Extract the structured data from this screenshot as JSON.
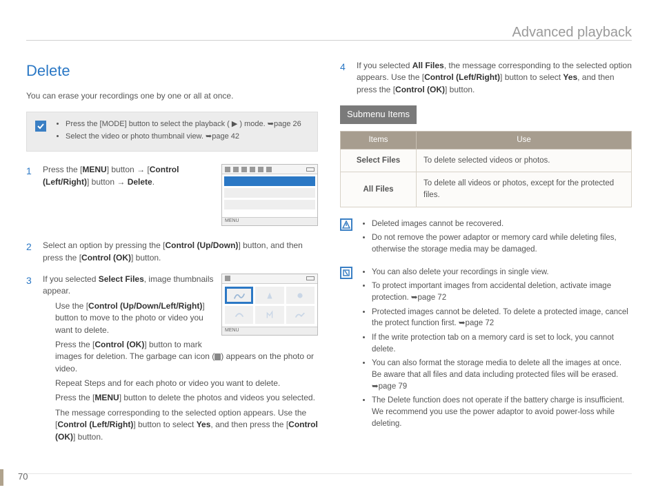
{
  "header": {
    "section_title": "Advanced playback"
  },
  "left": {
    "title": "Delete",
    "intro": "You can erase your recordings one by one or all at once.",
    "notebox": {
      "items": [
        "Press the [MODE] button to select the playback ( ▶ ) mode. ➥page 26",
        "Select the video or photo thumbnail view. ➥page 42"
      ]
    },
    "steps": {
      "s1": {
        "num": "1",
        "body_pre": "Press the [",
        "menu": "MENU",
        "body_mid1": "] button → [",
        "ctrl_lr": "Control (Left/Right)",
        "body_mid2": "] button → ",
        "delete": "Delete",
        "body_end": "."
      },
      "s2": {
        "num": "2",
        "body_pre": "Select an option by pressing the [",
        "ctrl_ud": "Control (Up/Down)",
        "body_mid": "] button, and then press the [",
        "ctrl_ok": "Control (OK)",
        "body_end": "] button."
      },
      "s3": {
        "num": "3",
        "line1_pre": "If you selected ",
        "sel_files": "Select Files",
        "line1_post": ", image thumbnails appear.",
        "sub1_pre": "Use the [",
        "ctrl_udlr": "Control (Up/Down/Left/Right)",
        "sub1_post": "] button to move to the photo or video you want to delete.",
        "sub2_pre": "Press the [",
        "ctrl_ok2": "Control (OK)",
        "sub2_mid": "] button to mark images for deletion. The garbage can icon (",
        "sub2_post": ") appears on the photo or video.",
        "sub3": "Repeat Steps      and      for each photo or video you want to delete.",
        "sub4_pre": "Press the [",
        "menu2": "MENU",
        "sub4_post": "] button to delete the photos and videos you selected.",
        "sub5": "The message corresponding to the selected option appears. Use the [",
        "ctrl_lr2": "Control (Left/Right)",
        "sub5_mid": "] button to select ",
        "yes": "Yes",
        "sub5_end": ", and then press the [",
        "ctrl_ok3": "Control (OK)",
        "sub5_close": "] button."
      }
    },
    "fig_menu_label": "MENU"
  },
  "right": {
    "s4": {
      "num": "4",
      "pre": "If you selected ",
      "all_files": "All Files",
      "mid1": ", the message corresponding to the selected option appears. Use the [",
      "ctrl_lr": "Control (Left/Right)",
      "mid2": "] button to select ",
      "yes": "Yes",
      "mid3": ", and then press the [",
      "ctrl_ok": "Control (OK)",
      "end": "] button."
    },
    "submenu_label": "Submenu Items",
    "table": {
      "h1": "Items",
      "h2": "Use",
      "r1k": "Select Files",
      "r1v": "To delete selected videos or photos.",
      "r2k": "All Files",
      "r2v": "To delete all videos or photos, except for the protected files."
    },
    "warn": {
      "items": [
        "Deleted images cannot be recovered.",
        "Do not remove the power adaptor or memory card while deleting files, otherwise the storage media may be damaged."
      ]
    },
    "tips": {
      "items": [
        "You can also delete your recordings in single view.",
        "To protect important images from accidental deletion, activate image protection. ➥page 72",
        "Protected images cannot be deleted. To delete a protected image, cancel the protect function first. ➥page 72",
        "If the write protection tab on a memory card is set to lock, you cannot delete.",
        "You can also format the storage media to delete all the images at once. Be aware that all files and data including protected files will be erased. ➥page 79",
        "The Delete function does not operate if the battery charge is insufficient. We recommend you use the power adaptor to avoid power-loss while deleting."
      ]
    }
  },
  "page_number": "70"
}
